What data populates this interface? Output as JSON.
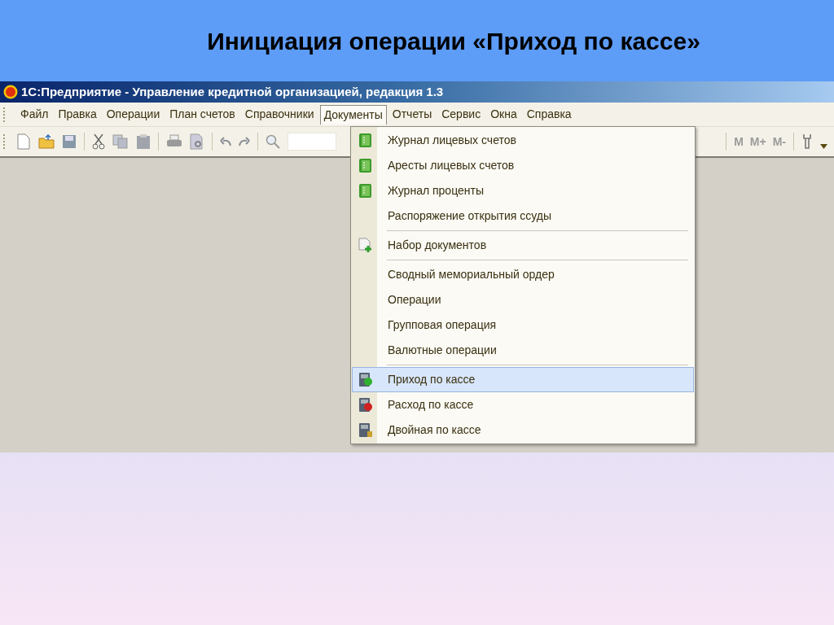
{
  "slide_title": "Инициация операции «Приход по кассе»",
  "window": {
    "title": "1С:Предприятие - Управление кредитной организацией, редакция 1.3"
  },
  "menubar": [
    {
      "label": "Файл",
      "selected": false
    },
    {
      "label": "Правка",
      "selected": false
    },
    {
      "label": "Операции",
      "selected": false
    },
    {
      "label": "План счетов",
      "selected": false
    },
    {
      "label": "Справочники",
      "selected": false
    },
    {
      "label": "Документы",
      "selected": true
    },
    {
      "label": "Отчеты",
      "selected": false
    },
    {
      "label": "Сервис",
      "selected": false
    },
    {
      "label": "Окна",
      "selected": false
    },
    {
      "label": "Справка",
      "selected": false
    }
  ],
  "toolbar": {
    "memory_buttons": [
      "M",
      "M+",
      "M-"
    ]
  },
  "menu": {
    "groups": [
      [
        {
          "label": "Журнал лицевых счетов",
          "kind": "ledger",
          "selected": false
        },
        {
          "label": "Аресты лицевых счетов",
          "kind": "ledger",
          "selected": false
        },
        {
          "label": "Журнал проценты",
          "kind": "ledger",
          "selected": false
        },
        {
          "label": "Распоряжение открытия ссуды",
          "kind": "plain",
          "selected": false
        }
      ],
      [
        {
          "label": "Набор документов",
          "kind": "docset",
          "selected": false
        }
      ],
      [
        {
          "label": "Сводный мемориальный ордер",
          "kind": "plain",
          "selected": false
        },
        {
          "label": "Операции",
          "kind": "plain",
          "selected": false
        },
        {
          "label": "Групповая операция",
          "kind": "plain",
          "selected": false
        },
        {
          "label": "Валютные операции",
          "kind": "plain",
          "selected": false
        }
      ],
      [
        {
          "label": "Приход по кассе",
          "kind": "cashin",
          "selected": true
        },
        {
          "label": "Расход по кассе",
          "kind": "cashout",
          "selected": false
        },
        {
          "label": "Двойная по кассе",
          "kind": "cashdouble",
          "selected": false
        }
      ]
    ]
  }
}
